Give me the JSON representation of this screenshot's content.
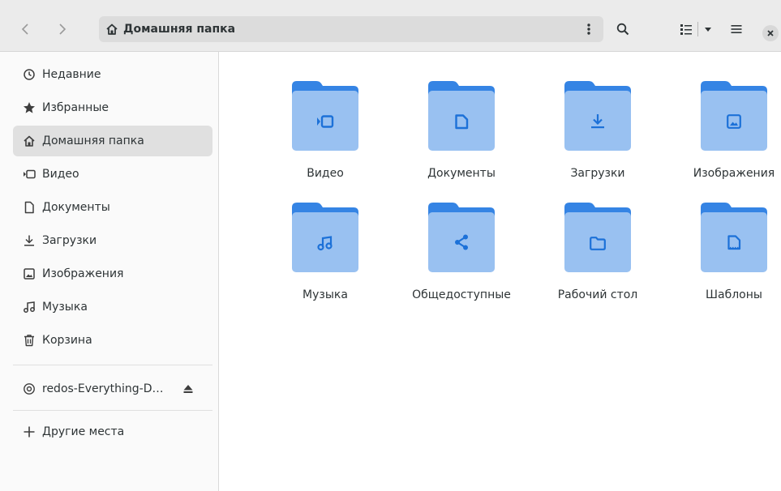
{
  "header": {
    "path_label": "Домашняя папка",
    "close_glyph": "×"
  },
  "sidebar": {
    "items": [
      {
        "label": "Недавние",
        "icon": "clock-icon"
      },
      {
        "label": "Избранные",
        "icon": "star-icon"
      },
      {
        "label": "Домашняя папка",
        "icon": "home-icon"
      },
      {
        "label": "Видео",
        "icon": "video-icon"
      },
      {
        "label": "Документы",
        "icon": "document-icon"
      },
      {
        "label": "Загрузки",
        "icon": "download-icon"
      },
      {
        "label": "Изображения",
        "icon": "image-icon"
      },
      {
        "label": "Музыка",
        "icon": "music-icon"
      },
      {
        "label": "Корзина",
        "icon": "trash-icon"
      }
    ],
    "device": {
      "label": "redos-Everything-D…",
      "icon": "disc-icon"
    },
    "other": {
      "label": "Другие места",
      "icon": "plus-icon"
    }
  },
  "folders": [
    {
      "label": "Видео",
      "icon": "video-icon"
    },
    {
      "label": "Документы",
      "icon": "document-icon"
    },
    {
      "label": "Загрузки",
      "icon": "download-icon"
    },
    {
      "label": "Изображения",
      "icon": "image-icon"
    },
    {
      "label": "Музыка",
      "icon": "music-icon"
    },
    {
      "label": "Общедоступные",
      "icon": "share-icon"
    },
    {
      "label": "Рабочий стол",
      "icon": "desktop-folder-icon"
    },
    {
      "label": "Шаблоны",
      "icon": "template-icon"
    }
  ],
  "colors": {
    "folder_back": "#3584e4",
    "folder_front": "#99c1f1",
    "folder_glyph": "#1c71d8",
    "active_item_bg": "#e0e0e0"
  }
}
